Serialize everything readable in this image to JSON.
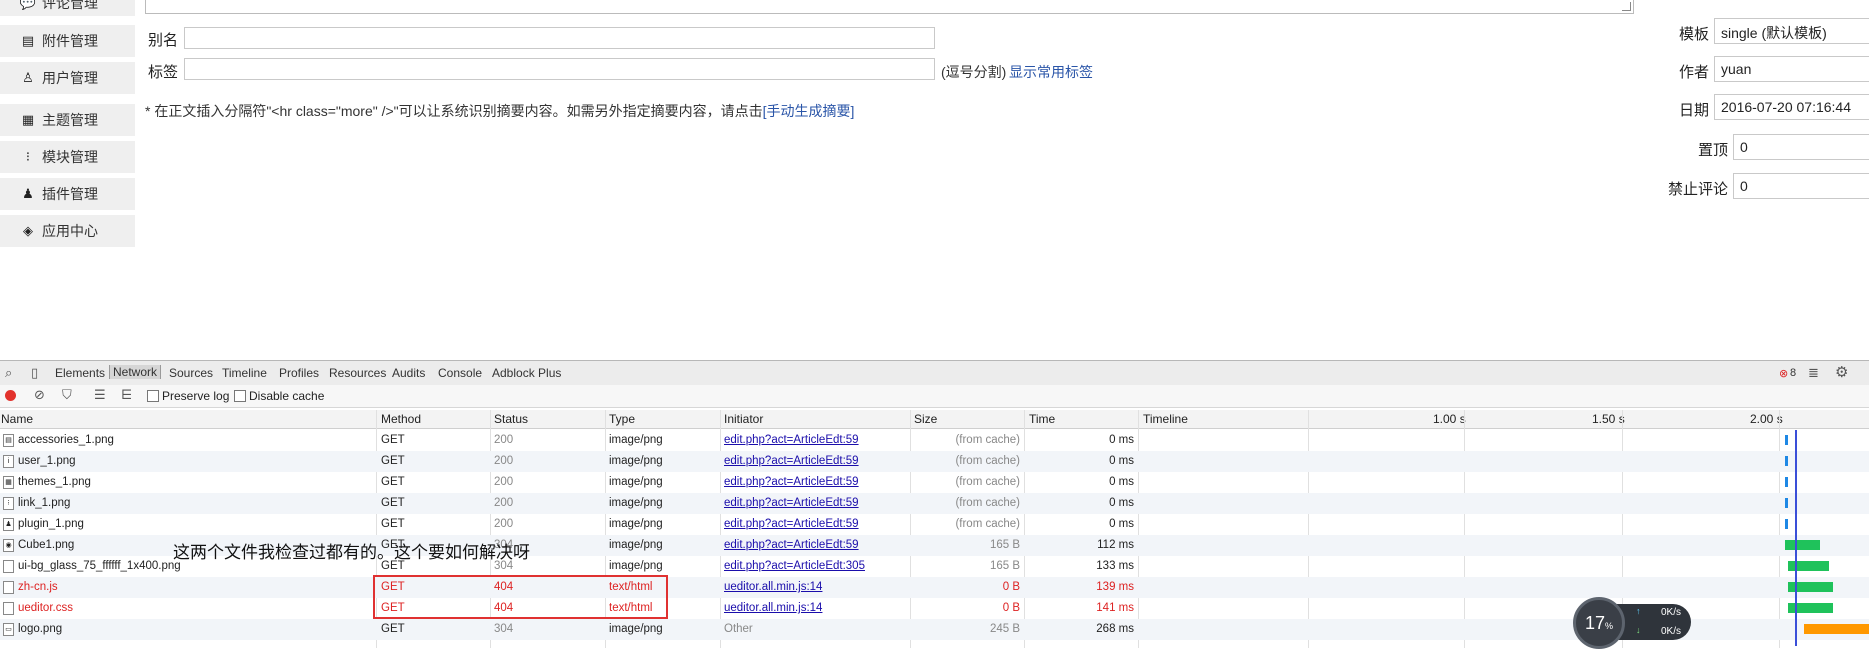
{
  "sidebar": {
    "items": [
      {
        "label": "评论管理",
        "icon": "comment-icon"
      },
      {
        "label": "附件管理",
        "icon": "attachment-icon"
      },
      {
        "label": "用户管理",
        "icon": "user-icon"
      },
      {
        "label": "主题管理",
        "icon": "theme-icon"
      },
      {
        "label": "模块管理",
        "icon": "module-icon"
      },
      {
        "label": "插件管理",
        "icon": "plugin-icon"
      },
      {
        "label": "应用中心",
        "icon": "app-center-icon"
      }
    ]
  },
  "form": {
    "alias_label": "别名",
    "alias_value": "",
    "tags_label": "标签",
    "tags_value": "",
    "tags_hint": "(逗号分割)",
    "tags_link": "显示常用标签",
    "summary_hint": "* 在正文插入分隔符\"<hr class=\"more\" />\"可以让系统识别摘要内容。如需另外指定摘要内容，请点击",
    "summary_link": "[手动生成摘要]"
  },
  "settings": {
    "template_label": "模板",
    "template_value": "single (默认模板)",
    "author_label": "作者",
    "author_value": "yuan",
    "date_label": "日期",
    "date_value": "2016-07-20 07:16:44",
    "top_label": "置顶",
    "top_value": "0",
    "nocomment_label": "禁止评论",
    "nocomment_value": "0"
  },
  "devtools": {
    "tabs": [
      "Elements",
      "Network",
      "Sources",
      "Timeline",
      "Profiles",
      "Resources",
      "Audits",
      "Console",
      "Adblock Plus"
    ],
    "active_tab": "Network",
    "error_count": "8",
    "preserve_log": "Preserve log",
    "disable_cache": "Disable cache",
    "columns": [
      "Name",
      "Method",
      "Status",
      "Type",
      "Initiator",
      "Size",
      "Time",
      "Timeline"
    ],
    "ticks": [
      "1.00 s",
      "1.50 s",
      "2.00 s"
    ],
    "rows": [
      {
        "name": "accessories_1.png",
        "method": "GET",
        "status": "200",
        "type": "image/png",
        "initiator": "edit.php?act=ArticleEdt:59",
        "size": "(from cache)",
        "time": "0 ms",
        "error": false,
        "icon_char": "▤",
        "wf_start": 2.02,
        "wf_end": 2.03
      },
      {
        "name": "user_1.png",
        "method": "GET",
        "status": "200",
        "type": "image/png",
        "initiator": "edit.php?act=ArticleEdt:59",
        "size": "(from cache)",
        "time": "0 ms",
        "error": false,
        "icon_char": "i",
        "wf_start": 2.02,
        "wf_end": 2.03
      },
      {
        "name": "themes_1.png",
        "method": "GET",
        "status": "200",
        "type": "image/png",
        "initiator": "edit.php?act=ArticleEdt:59",
        "size": "(from cache)",
        "time": "0 ms",
        "error": false,
        "icon_char": "▦",
        "wf_start": 2.02,
        "wf_end": 2.03
      },
      {
        "name": "link_1.png",
        "method": "GET",
        "status": "200",
        "type": "image/png",
        "initiator": "edit.php?act=ArticleEdt:59",
        "size": "(from cache)",
        "time": "0 ms",
        "error": false,
        "icon_char": "⁝",
        "wf_start": 2.02,
        "wf_end": 2.03
      },
      {
        "name": "plugin_1.png",
        "method": "GET",
        "status": "200",
        "type": "image/png",
        "initiator": "edit.php?act=ArticleEdt:59",
        "size": "(from cache)",
        "time": "0 ms",
        "error": false,
        "icon_char": "♟",
        "wf_start": 2.02,
        "wf_end": 2.03
      },
      {
        "name": "Cube1.png",
        "method": "GET",
        "status": "304",
        "type": "image/png",
        "initiator": "edit.php?act=ArticleEdt:59",
        "size": "165 B",
        "time": "112 ms",
        "error": false,
        "icon_char": "◉",
        "wf_start": 2.02,
        "wf_end": 2.13
      },
      {
        "name": "ui-bg_glass_75_ffffff_1x400.png",
        "method": "GET",
        "status": "304",
        "type": "image/png",
        "initiator": "edit.php?act=ArticleEdt:305",
        "size": "165 B",
        "time": "133 ms",
        "error": false,
        "icon_char": "",
        "wf_start": 2.03,
        "wf_end": 2.16
      },
      {
        "name": "zh-cn.js",
        "method": "GET",
        "status": "404",
        "type": "text/html",
        "initiator": "ueditor.all.min.js:14",
        "size": "0 B",
        "time": "139 ms",
        "error": true,
        "icon_char": "",
        "wf_start": 2.03,
        "wf_end": 2.17
      },
      {
        "name": "ueditor.css",
        "method": "GET",
        "status": "404",
        "type": "text/html",
        "initiator": "ueditor.all.min.js:14",
        "size": "0 B",
        "time": "141 ms",
        "error": true,
        "icon_char": "",
        "wf_start": 2.03,
        "wf_end": 2.17
      },
      {
        "name": "logo.png",
        "method": "GET",
        "status": "304",
        "type": "image/png",
        "initiator": "Other",
        "size": "245 B",
        "time": "268 ms",
        "error": false,
        "icon_char": "▭",
        "wf_start": 2.08,
        "wf_end": 2.35
      }
    ]
  },
  "annotation": "这两个文件我检查过都有的。这个要如何解决呀",
  "speed_widget": {
    "percent": "17",
    "percent_unit": "%",
    "up": "0K/s",
    "down": "0K/s"
  },
  "colors": {
    "error": "#dd2222",
    "link": "#1a0dab",
    "waterfall_green": "#1fc25b",
    "waterfall_blue": "#1e88e5",
    "waterfall_orange": "#ff9800",
    "highlight_box": "#e03131"
  }
}
